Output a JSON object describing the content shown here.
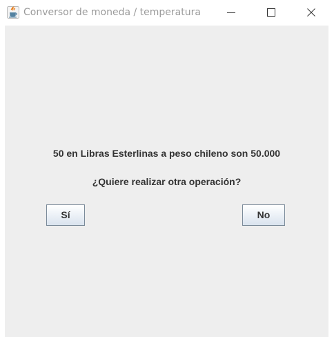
{
  "window": {
    "title": "Conversor de moneda / temperatura",
    "icon": "java-icon"
  },
  "dialog": {
    "message_line1": "50 en Libras Esterlinas a peso chileno son 50.000",
    "message_line2": "¿Quiere realizar otra operación?",
    "yes_label": "Sí",
    "no_label": "No"
  },
  "colors": {
    "content_background": "#eeeeee",
    "title_text": "#9a9a9a",
    "button_border": "#7a8a99"
  }
}
